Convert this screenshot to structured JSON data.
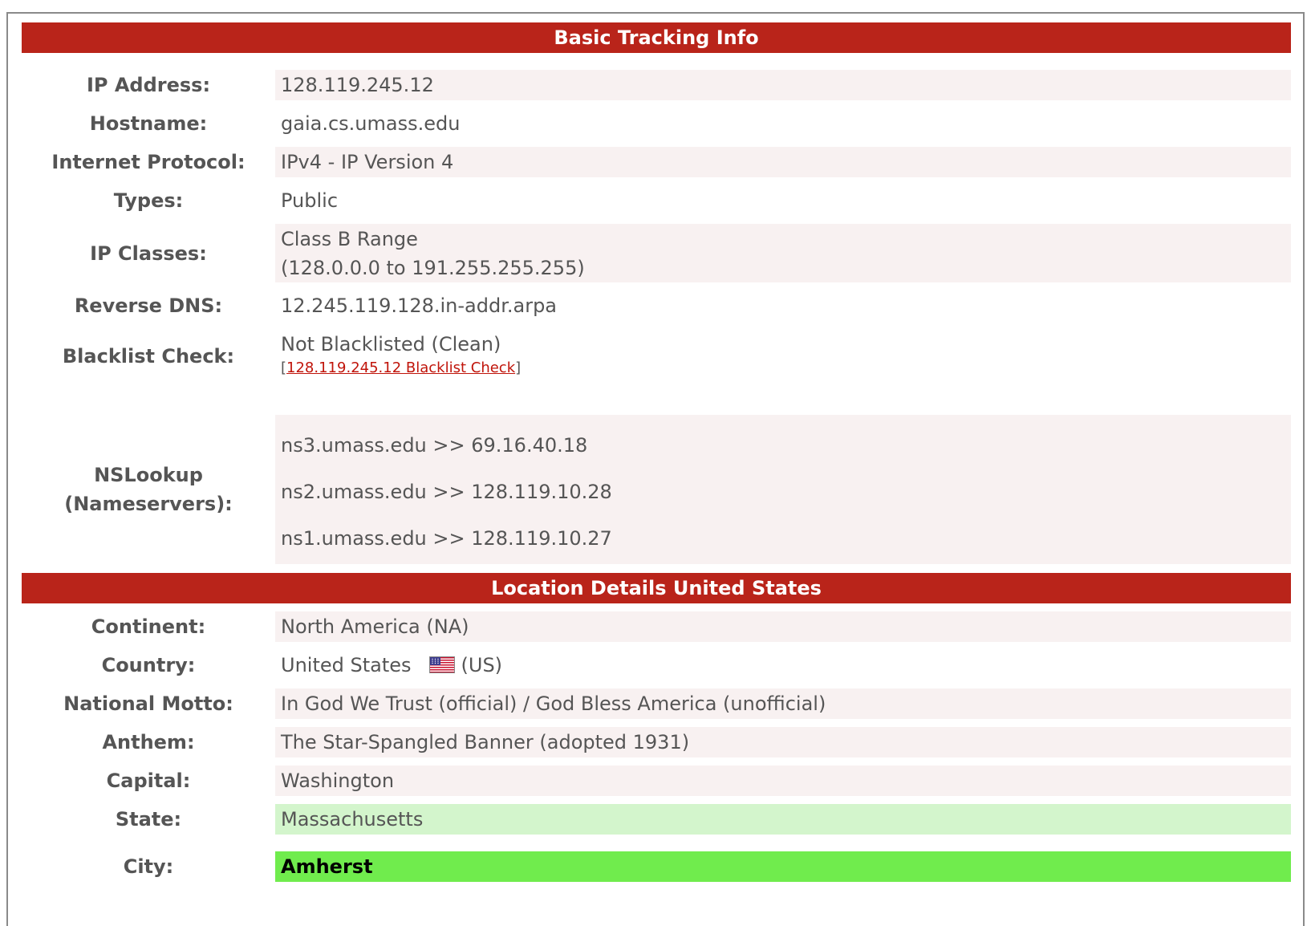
{
  "sections": {
    "basic": {
      "title": "Basic Tracking Info"
    },
    "location": {
      "title": "Location Details United States"
    }
  },
  "basic": {
    "ip": {
      "label": "IP Address:",
      "value": "128.119.245.12"
    },
    "hostname": {
      "label": "Hostname:",
      "value": "gaia.cs.umass.edu"
    },
    "protocol": {
      "label": "Internet Protocol:",
      "value": "IPv4 - IP Version 4"
    },
    "types": {
      "label": "Types:",
      "value": "Public"
    },
    "classes": {
      "label": "IP Classes:",
      "line1": "Class B Range",
      "line2": "(128.0.0.0 to 191.255.255.255)"
    },
    "rdns": {
      "label": "Reverse DNS:",
      "value": "12.245.119.128.in-addr.arpa"
    },
    "blacklist": {
      "label": "Blacklist Check:",
      "value": "Not Blacklisted (Clean)",
      "link_prefix": "[",
      "link_text": "128.119.245.12 Blacklist Check",
      "link_suffix": "]"
    },
    "nslookup": {
      "label_line1": "NSLookup",
      "label_line2": "(Nameservers):",
      "servers": [
        "ns3.umass.edu >> 69.16.40.18",
        "ns2.umass.edu >> 128.119.10.28",
        "ns1.umass.edu >> 128.119.10.27"
      ]
    }
  },
  "location": {
    "continent": {
      "label": "Continent:",
      "value": "North America (NA)"
    },
    "country": {
      "label": "Country:",
      "name": "United States",
      "code": "(US)",
      "flag_icon": "us-flag-icon"
    },
    "motto": {
      "label": "National Motto:",
      "value": "In God We Trust (official) / God Bless America (unofficial)"
    },
    "anthem": {
      "label": "Anthem:",
      "value": "The Star-Spangled Banner (adopted 1931)"
    },
    "capital": {
      "label": "Capital:",
      "value": "Washington"
    },
    "state": {
      "label": "State:",
      "value": "Massachusetts"
    },
    "city": {
      "label": "City:",
      "value": "Amherst"
    }
  },
  "colors": {
    "header_bg": "#b9241a",
    "row_shade": "#f8f1f1",
    "state_highlight": "#d3f5cc",
    "city_highlight": "#70ec4d",
    "link": "#c0140a"
  }
}
